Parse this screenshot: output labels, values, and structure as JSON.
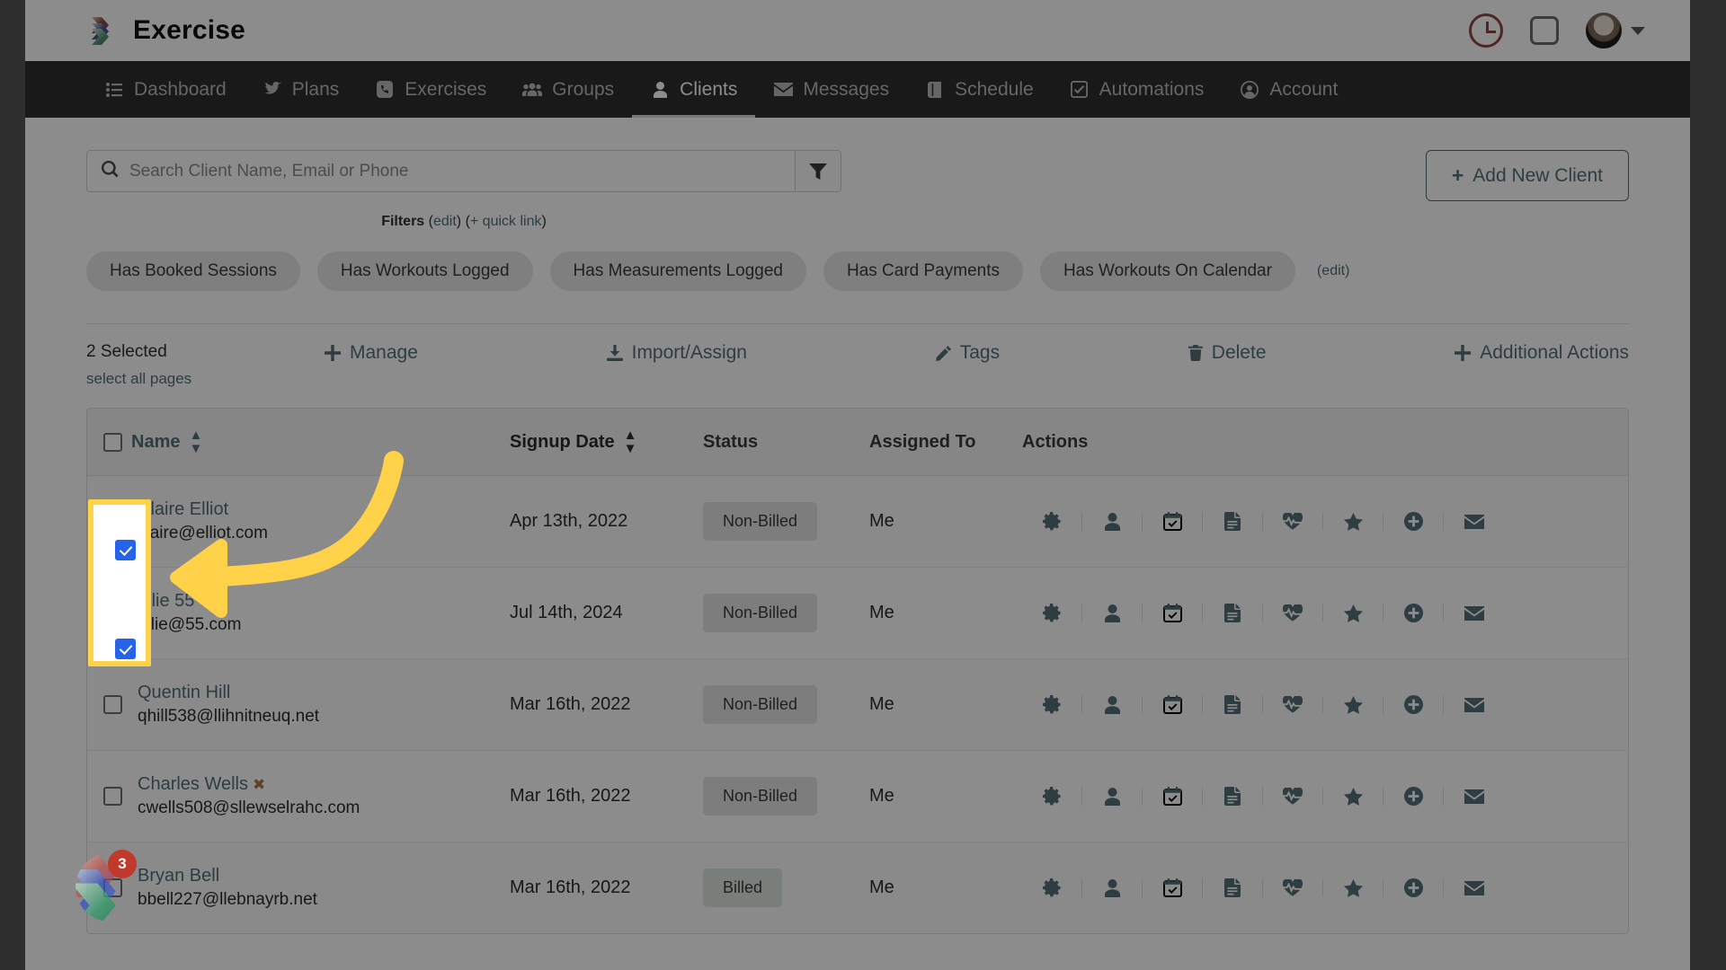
{
  "header": {
    "brand_title": "Exercise",
    "icons": [
      {
        "name": "clock-icon",
        "color": "#c0392b"
      },
      {
        "name": "square-icon",
        "color": "#6b6b6b"
      },
      {
        "name": "avatar"
      },
      {
        "name": "chevron-down-icon"
      }
    ]
  },
  "nav": {
    "items": [
      {
        "label": "Dashboard",
        "icon": "list-icon",
        "active": false
      },
      {
        "label": "Plans",
        "icon": "twitter-bird-icon",
        "active": false
      },
      {
        "label": "Exercises",
        "icon": "phone-icon",
        "active": false
      },
      {
        "label": "Groups",
        "icon": "users-icon",
        "active": false
      },
      {
        "label": "Clients",
        "icon": "user-icon",
        "active": true
      },
      {
        "label": "Messages",
        "icon": "envelope-icon",
        "active": false
      },
      {
        "label": "Schedule",
        "icon": "book-icon",
        "active": false
      },
      {
        "label": "Automations",
        "icon": "check-square-icon",
        "active": false
      },
      {
        "label": "Account",
        "icon": "user-circle-icon",
        "active": false
      }
    ]
  },
  "search": {
    "placeholder": "Search Client Name, Email or Phone",
    "value": "",
    "filter_button_icon": "funnel-icon"
  },
  "add_client": {
    "label": "Add New Client",
    "plus": "+"
  },
  "filters": {
    "label": "Filters",
    "edit_label": "edit",
    "quick_link_label": "+ quick link",
    "open_paren": "(",
    "close_paren": ")",
    "pills": [
      "Has Booked Sessions",
      "Has Workouts Logged",
      "Has Measurements Logged",
      "Has Card Payments",
      "Has Workouts On Calendar"
    ],
    "pills_edit": "(edit)"
  },
  "toolbar": {
    "selected_count": "2 Selected",
    "select_all_pages": "select all pages",
    "actions": [
      {
        "label": "Manage",
        "icon": "plus-icon"
      },
      {
        "label": "Import/Assign",
        "icon": "download-icon"
      },
      {
        "label": "Tags",
        "icon": "pencil-icon"
      },
      {
        "label": "Delete",
        "icon": "trash-icon"
      },
      {
        "label": "Additional Actions",
        "icon": "plus-icon"
      }
    ]
  },
  "table": {
    "columns": [
      {
        "label": "Name",
        "sortable": true,
        "link": true
      },
      {
        "label": "Signup Date",
        "sortable": true,
        "link": true
      },
      {
        "label": "Status",
        "sortable": false,
        "link": false
      },
      {
        "label": "Assigned To",
        "sortable": false,
        "link": false
      },
      {
        "label": "Actions",
        "sortable": false,
        "link": false
      }
    ],
    "header_checkbox_checked": false,
    "row_action_icons": [
      "gear-icon",
      "person-icon",
      "calendar-check-icon",
      "document-icon",
      "heartbeat-icon",
      "star-icon",
      "plus-circle-icon",
      "envelope-icon"
    ],
    "rows": [
      {
        "checked": true,
        "name": "Claire Elliot",
        "email": "claire@elliot.com",
        "has_xmark": false,
        "signup_date": "Apr 13th, 2022",
        "status": "Non-Billed",
        "assigned_to": "Me"
      },
      {
        "checked": true,
        "name": "allie 55",
        "email": "allie@55.com",
        "has_xmark": true,
        "signup_date": "Jul 14th, 2024",
        "status": "Non-Billed",
        "assigned_to": "Me"
      },
      {
        "checked": false,
        "name": "Quentin Hill",
        "email": "qhill538@llihnitneuq.net",
        "has_xmark": false,
        "signup_date": "Mar 16th, 2022",
        "status": "Non-Billed",
        "assigned_to": "Me"
      },
      {
        "checked": false,
        "name": "Charles Wells",
        "email": "cwells508@sllewselrahc.com",
        "has_xmark": true,
        "signup_date": "Mar 16th, 2022",
        "status": "Non-Billed",
        "assigned_to": "Me"
      },
      {
        "checked": false,
        "name": "Bryan Bell",
        "email": "bbell227@llebnayrb.net",
        "has_xmark": false,
        "signup_date": "Mar 16th, 2022",
        "status": "Billed",
        "assigned_to": "Me"
      }
    ]
  },
  "chat_widget": {
    "badge_count": "3"
  },
  "annotation": {
    "highlight_color": "#ffd24a",
    "arrow_color": "#ffd24a"
  }
}
